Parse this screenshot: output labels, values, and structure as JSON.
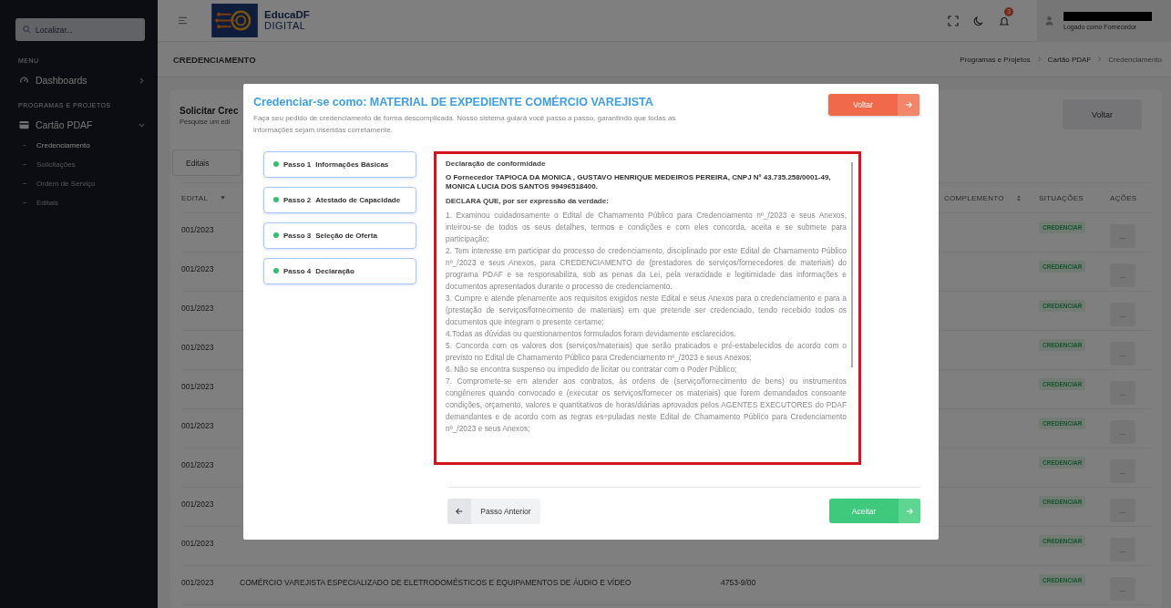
{
  "sidebar": {
    "search": {
      "placeholder": "Localizar..."
    },
    "menu_heading": "MENU",
    "dashboards": {
      "label": "Dashboards"
    },
    "section_heading": "PROGRAMAS E PROJETOS",
    "group": {
      "label": "Cartão PDAF",
      "expanded": true,
      "children": [
        {
          "label": "Credenciamento",
          "selected": true
        },
        {
          "label": "Solicitações",
          "selected": false
        },
        {
          "label": "Ordem de Serviço",
          "selected": false
        },
        {
          "label": "Editais",
          "selected": false
        }
      ]
    }
  },
  "header": {
    "logo_title": "EducaDF",
    "logo_subtitle": "DIGITAL",
    "notification_count": "3",
    "user_role": "Logado como Fornecedor"
  },
  "breadcrumb": {
    "page_title": "CREDENCIAMENTO",
    "trail": [
      {
        "label": "Programas e Projetos",
        "current": false
      },
      {
        "label": "Cartão PDAF",
        "current": false
      },
      {
        "label": "Credenciamento",
        "current": true
      }
    ]
  },
  "page": {
    "title": "Solicitar Crec",
    "subtitle": "Pesquise um edi",
    "back_button": "Voltar",
    "filter": "Editais",
    "table": {
      "columns": [
        "EDITAL",
        "COMPLEMENTO",
        "SITUAÇÕES",
        "AÇÕES"
      ],
      "rows": [
        {
          "edital": "001/2023",
          "status": "CREDENCIAR",
          "action": "..."
        },
        {
          "edital": "001/2023",
          "status": "CREDENCIAR",
          "action": "..."
        },
        {
          "edital": "001/2023",
          "status": "CREDENCIAR",
          "action": "..."
        },
        {
          "edital": "001/2023",
          "status": "CREDENCIAR",
          "action": "..."
        },
        {
          "edital": "001/2023",
          "status": "CREDENCIAR",
          "action": "..."
        },
        {
          "edital": "001/2023",
          "status": "CREDENCIAR",
          "action": "..."
        },
        {
          "edital": "001/2023",
          "status": "CREDENCIAR",
          "action": "..."
        },
        {
          "edital": "001/2023",
          "status": "CREDENCIAR",
          "action": "..."
        },
        {
          "edital": "001/2023",
          "status": "CREDENCIAR",
          "action": "..."
        },
        {
          "edital": "001/2023",
          "description": "COMÉRCIO VAREJISTA ESPECIALIZADO DE ELETRODOMÉSTICOS E EQUIPAMENTOS DE ÁUDIO E VÍDEO",
          "code": "4753-9/00",
          "status": "CREDENCIAR",
          "action": "..."
        }
      ]
    }
  },
  "modal": {
    "title": "Credenciar-se como: MATERIAL DE EXPEDIENTE COMÉRCIO VAREJISTA",
    "description": "Faça seu pedido de credenciamento de forma descomplicada. Nosso sistema guiará você passo a passo, garantindo que todas as informações sejam inseridas corretamente.",
    "back_button": "Voltar",
    "steps": [
      {
        "label": "Passo 1",
        "title": "Informações Básicas",
        "completed": true
      },
      {
        "label": "Passo 2",
        "title": "Atestado de Capacidade",
        "completed": true
      },
      {
        "label": "Passo 3",
        "title": "Seleção de Oferta",
        "completed": true
      },
      {
        "label": "Passo 4",
        "title": "Declaração",
        "completed": true
      }
    ],
    "declaration": {
      "heading": "Declaração de conformidade",
      "supplier": "O Fornecedor TAPIOCA DA MONICA , GUSTAVO HENRIQUE MEDEIROS PEREIRA, CNPJ Nº 43.735.258/0001-49, MONICA LUCIA DOS SANTOS 99496518400.",
      "declares": "DECLARA QUE, por ser expressão da verdade:",
      "items": [
        "1. Examinou cuidadosamente o Edital de Chamamento Público para Credenciamento nº_/2023 e seus Anexos, inteirou-se de todos os seus detalhes, termos e condições e com eles concorda, aceita e se submete para participação;",
        "2. Tem interesse em participar do processo de credenciamento, disciplinado por este Edital de Chamamento Público nº_/2023 e seus Anexos, para CREDENCIAMENTO de (prestadores de serviços/fornecedores de materiais) do programa PDAF e se responsabiliza, sob as penas da Lei, pela veracidade e legitimidade das informações e documentos apresentados durante o processo de credenciamento.",
        "3. Cumpre e atende plenamente aos requisitos exigidos neste Edital e seus Anexos para o credenciamento e para a (prestação de serviços/fornecimento de materiais) em que pretende ser credenciado, tendo recebido todos os documentos que integram o presente certame;",
        "4.Todas as dúvidas ou questionamentos formulados foram devidamente esclarecidos.",
        "5. Concorda com os valores dos (serviços/materiais) que serão praticados e pré-estabelecidos de acordo com o previsto no Edital de Chamamento Público para Credenciamento nº_/2023 e seus Anexos;",
        "6. Não se encontra suspenso ou impedido de licitar ou contratar com o Poder Público;",
        "7. Compromete-se em atender aos contratos, às ordens de (serviço/fornecimento de bens) ou instrumentos congêneres quando convocado e (executar os serviços/fornecer os materiais) que forem demandados consoante condições, orçamento, valores e quantitativos de horas/diárias aprovados pelos AGENTES EXECUTORES do PDAF demandantes e de acordo com as regras es÷puladas neste Edital de Chamamento Público para Credenciamento nº_/2023 e seus Anexos;"
      ]
    },
    "previous_button": "Passo Anterior",
    "accept_button": "Aceitar"
  }
}
